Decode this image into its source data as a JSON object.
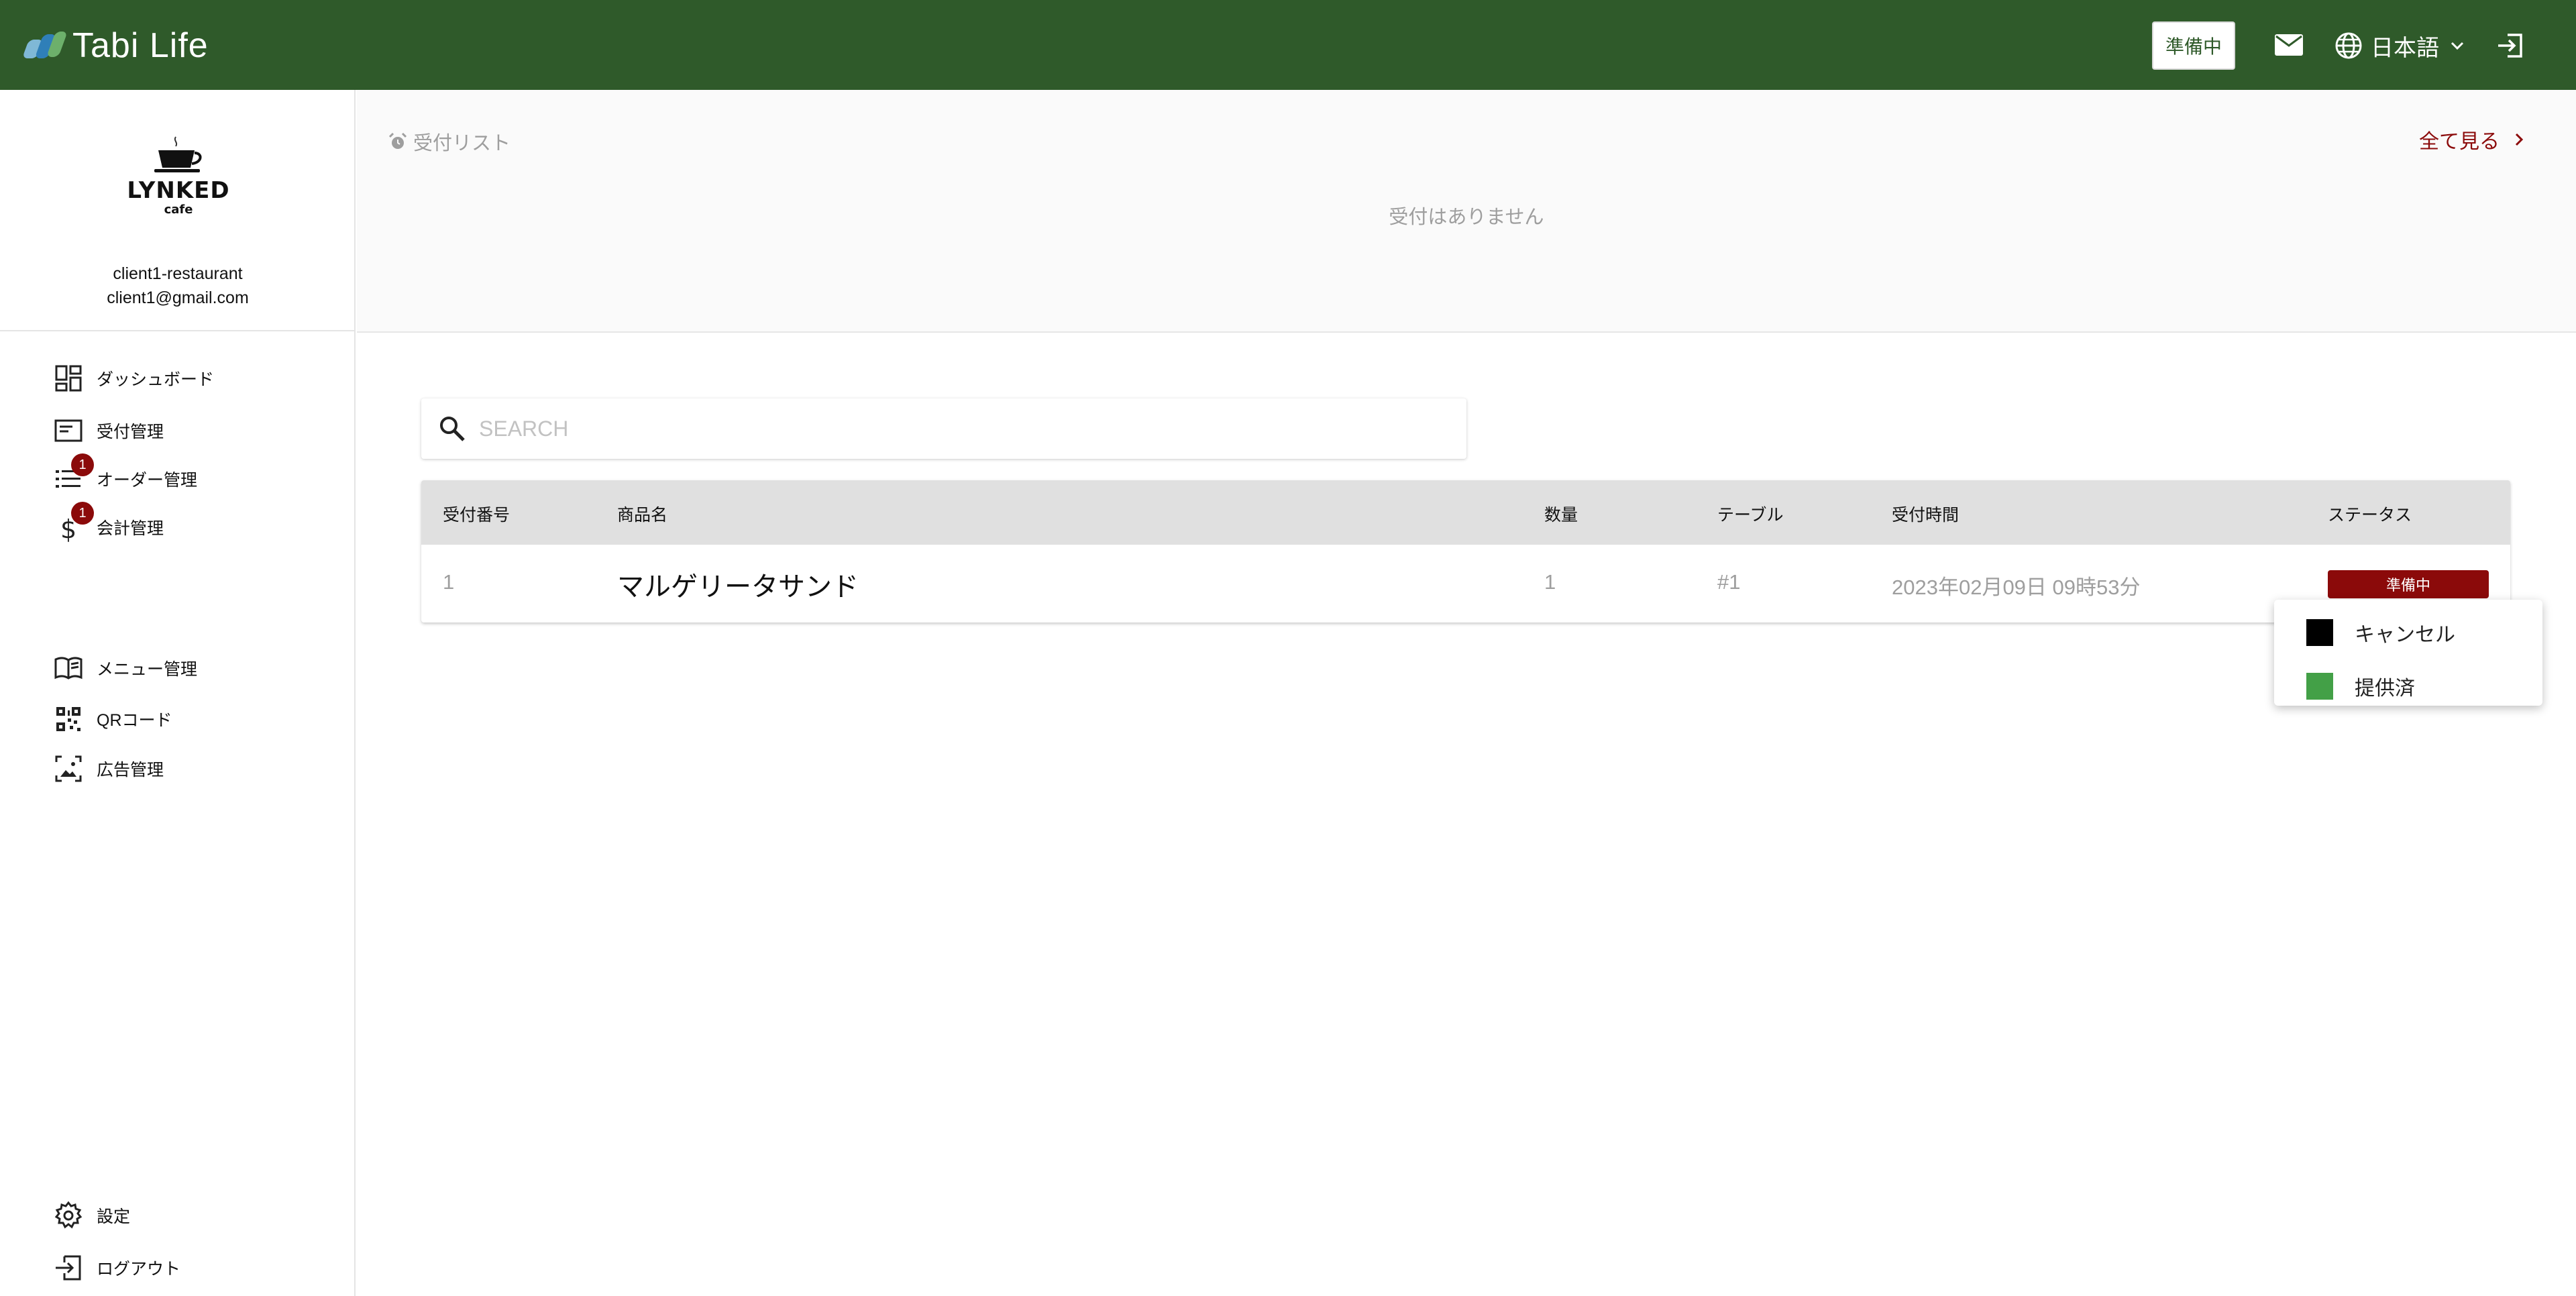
{
  "header": {
    "brand": "Tabi Life",
    "status_button": "準備中",
    "language": "日本語"
  },
  "sidebar": {
    "logo_text": "LYNKED",
    "logo_sub": "cafe",
    "account_name": "client1-restaurant",
    "account_email": "client1@gmail.com",
    "items": [
      {
        "label": "ダッシュボード",
        "icon": "dashboard-icon"
      },
      {
        "label": "受付管理",
        "icon": "reception-icon"
      },
      {
        "label": "オーダー管理",
        "icon": "list-icon",
        "badge": "1"
      },
      {
        "label": "会計管理",
        "icon": "dollar-icon",
        "badge": "1"
      },
      {
        "label": "メニュー管理",
        "icon": "menu-book-icon"
      },
      {
        "label": "QRコード",
        "icon": "qr-code-icon"
      },
      {
        "label": "広告管理",
        "icon": "ad-image-icon"
      }
    ],
    "settings_label": "設定",
    "logout_label": "ログアウト"
  },
  "reception": {
    "title": "受付リスト",
    "see_all": "全て見る",
    "empty_message": "受付はありません"
  },
  "search": {
    "placeholder": "SEARCH"
  },
  "orders_table": {
    "columns": [
      "受付番号",
      "商品名",
      "数量",
      "テーブル",
      "受付時間",
      "ステータス"
    ],
    "rows": [
      {
        "number": "1",
        "product": "マルゲリータサンド",
        "quantity": "1",
        "table": "#1",
        "time": "2023年02月09日 09時53分",
        "status": "準備中"
      }
    ]
  },
  "status_menu": {
    "options": [
      {
        "label": "キャンセル",
        "color": "#000000"
      },
      {
        "label": "提供済",
        "color": "#43a047"
      }
    ]
  },
  "colors": {
    "header_bg": "#2f5a2a",
    "accent": "#8b0a0a"
  }
}
